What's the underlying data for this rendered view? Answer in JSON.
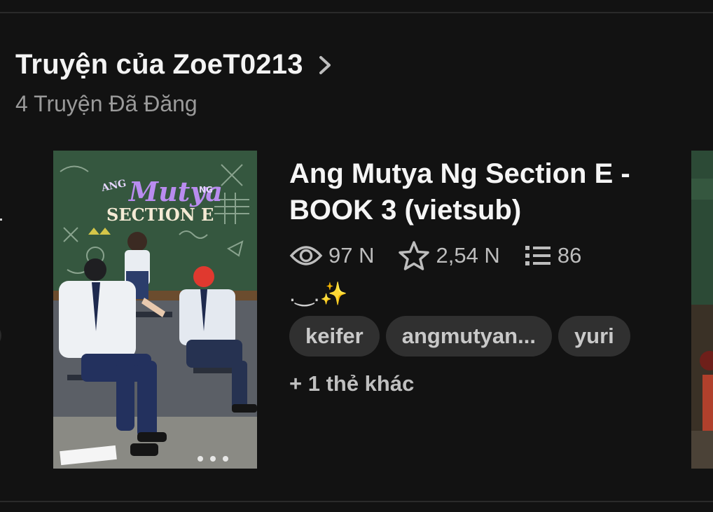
{
  "section": {
    "title": "Truyện của ZoeT0213",
    "subtitle": "4 Truyện Đã Đăng",
    "chevron_icon": "chevron-right-icon"
  },
  "story": {
    "title": "Ang Mutya Ng Section E - BOOK 3 (vietsub)",
    "cover_text": {
      "brand": "ANG",
      "script": "Mutya",
      "ng": "NG",
      "section": "SECTION E"
    },
    "stats": {
      "reads": "97 N",
      "votes": "2,54 N",
      "parts": "86"
    },
    "description": ".̵̵̵̵̵̵̵̵̵̵̵̵̵̵̵̵̵̵̵̵̵̵̵̵̵̵̵̵̵̵̵̵̵̵̵̵̵̵̵̵̵̵̵̵̵̵̵̵̵̵̵̵̵̵̵̵̵̵̵̵̵̵̵̵̵̵̵̵̵̵̵̵_.✨",
    "tags": [
      "keifer",
      "angmutyan...",
      "yuri"
    ],
    "more_tags": "+ 1 thẻ khác"
  },
  "icons": {
    "reads": "eye-icon",
    "votes": "star-icon",
    "parts": "list-icon"
  },
  "colors": {
    "background": "#121212",
    "tag_bg": "#303030",
    "muted_text": "#9a9a9a"
  }
}
